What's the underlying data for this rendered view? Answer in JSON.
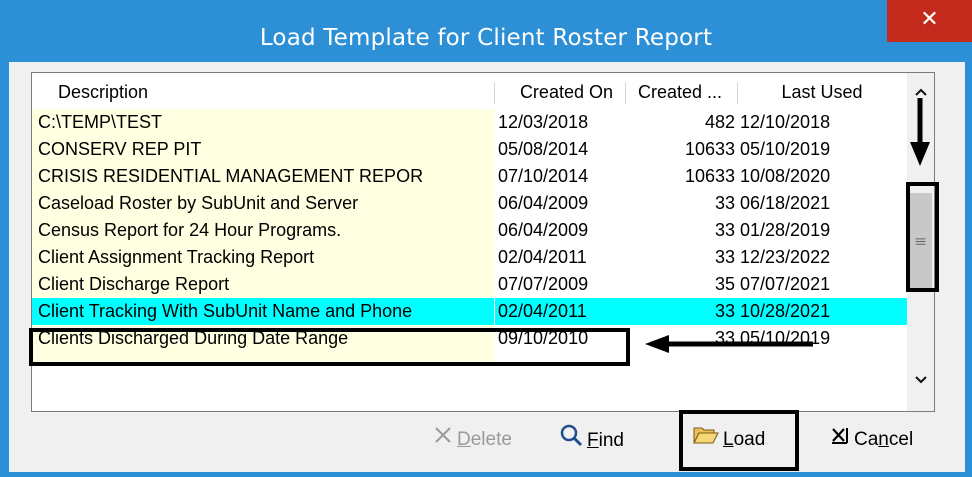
{
  "window": {
    "title": "Load Template for Client Roster Report",
    "close_glyph": "✕",
    "close_color": "#c42b1c",
    "title_color": "#2d8fd5"
  },
  "grid": {
    "columns": [
      "Description",
      "Created On",
      "Created ...",
      "Last Used"
    ],
    "rows": [
      {
        "description": "C:\\TEMP\\TEST",
        "created_on": "12/03/2018",
        "created_by": "482",
        "last_used": "12/10/2018"
      },
      {
        "description": "CONSERV REP PIT",
        "created_on": "05/08/2014",
        "created_by": "10633",
        "last_used": "05/10/2019"
      },
      {
        "description": "CRISIS RESIDENTIAL MANAGEMENT REPOR",
        "created_on": "07/10/2014",
        "created_by": "10633",
        "last_used": "10/08/2020"
      },
      {
        "description": "Caseload Roster by SubUnit and Server",
        "created_on": "06/04/2009",
        "created_by": "33",
        "last_used": "06/18/2021"
      },
      {
        "description": "Census Report for 24 Hour Programs.",
        "created_on": "06/04/2009",
        "created_by": "33",
        "last_used": "01/28/2019"
      },
      {
        "description": "Client Assignment Tracking Report",
        "created_on": "02/04/2011",
        "created_by": "33",
        "last_used": "12/23/2022"
      },
      {
        "description": "Client Discharge Report",
        "created_on": "07/07/2009",
        "created_by": "35",
        "last_used": "07/07/2021"
      },
      {
        "description": "Client Tracking With SubUnit Name and Phone",
        "created_on": "02/04/2011",
        "created_by": "33",
        "last_used": "10/28/2021"
      },
      {
        "description": "Clients Discharged During Date Range",
        "created_on": "09/10/2010",
        "created_by": "33",
        "last_used": "05/10/2019"
      }
    ],
    "selected_row_color": "#00ffff",
    "description_bg": "#ffffe1"
  },
  "scrollbar": {
    "up_icon": "chevron-up-icon",
    "down_icon": "chevron-down-icon"
  },
  "buttons": {
    "delete": {
      "underline": "D",
      "rest": "elete",
      "icon": "x-icon"
    },
    "find": {
      "underline": "F",
      "rest": "ind",
      "icon": "magnifier-icon"
    },
    "load": {
      "underline": "L",
      "rest": "oad",
      "icon": "open-folder-icon"
    },
    "cancel": {
      "prefix": "Ca",
      "underline": "n",
      "rest": "cel",
      "icon": "close-box-icon"
    }
  }
}
